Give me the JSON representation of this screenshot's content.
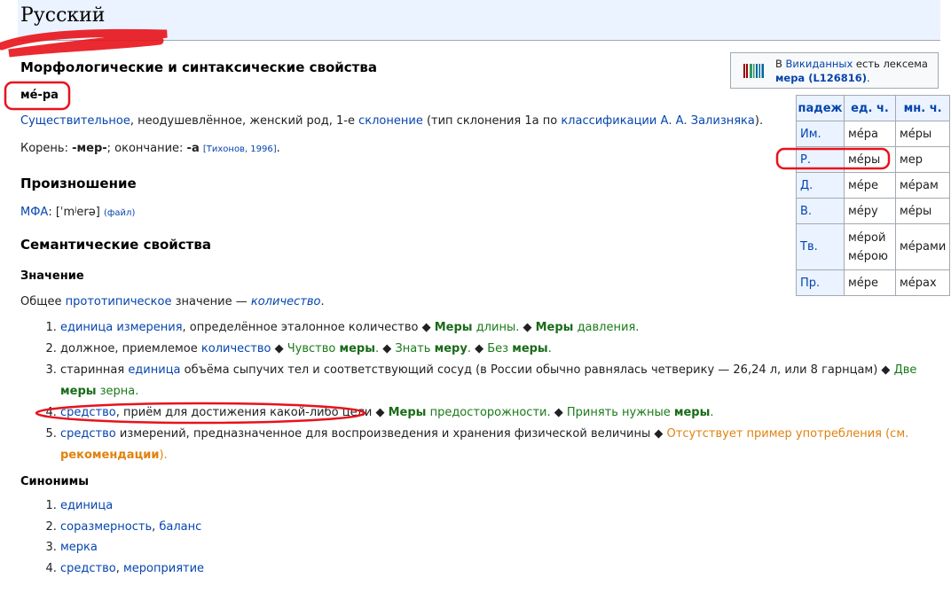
{
  "header": {
    "language": "Русский"
  },
  "morph": {
    "heading": "Морфологические и синтаксические свойства",
    "word": "ме́-ра",
    "pos_link": "Существительное",
    "pos_rest": ", неодушевлённое, женский род, 1-е ",
    "decl_link": "склонение",
    "type_text": " (тип склонения 1a по ",
    "class_link": "классификации А. А. Зализняка",
    "type_end": ").",
    "root_label": "Корень: ",
    "root_value": "-мер-",
    "ending_label": "; окончание: ",
    "ending_value": "-а",
    "source": "[Тихонов, 1996]",
    "source_end": "."
  },
  "wikidata": {
    "pre": "В ",
    "link": "Викиданных",
    "mid": " есть лексема",
    "lexeme": "мера (L126816)",
    "end": "."
  },
  "table": {
    "headers": [
      "падеж",
      "ед. ч.",
      "мн. ч."
    ],
    "rows": [
      {
        "case": "Им.",
        "sg": "ме́ра",
        "pl": "ме́ры"
      },
      {
        "case": "Р.",
        "sg": "ме́ры",
        "pl": "мер"
      },
      {
        "case": "Д.",
        "sg": "ме́ре",
        "pl": "ме́рам"
      },
      {
        "case": "В.",
        "sg": "ме́ру",
        "pl": "ме́ры"
      },
      {
        "case": "Тв.",
        "sg": "ме́рой",
        "sg2": "ме́рою",
        "pl": "ме́рами"
      },
      {
        "case": "Пр.",
        "sg": "ме́ре",
        "pl": "ме́рах"
      }
    ]
  },
  "pron": {
    "heading": "Произношение",
    "ipa_link": "МФА",
    "ipa_text": ": [ˈmʲerə]",
    "file_link": "(файл)"
  },
  "semantic": {
    "heading": "Семантические свойства",
    "meaning_heading": "Значение",
    "general_pre": "Общее ",
    "general_link": "прототипическое",
    "general_mid": " значение — ",
    "general_value": "количество",
    "general_end": ".",
    "defs": [
      {
        "link": "единица измерения",
        "text": ", определённое эталонное количество ◆ ",
        "ex1a": "Меры",
        "ex1b": " длины.",
        "sep": " ◆ ",
        "ex2a": "Меры",
        "ex2b": " давления."
      },
      {
        "pre": "должное, приемлемое ",
        "link": "количество",
        "text": " ◆ ",
        "ex1a": "Чувство ",
        "ex1b": "меры",
        "ex1c": ".",
        "sep1": " ◆ ",
        "ex2a": "Знать ",
        "ex2b": "меру",
        "ex2c": ".",
        "sep2": " ◆ ",
        "ex3a": "Без ",
        "ex3b": "меры",
        "ex3c": "."
      },
      {
        "pre": "старинная ",
        "link": "единица",
        "text": " объёма сыпучих тел и соответствующий сосуд (в России обычно равнялась четверику — 26,24 л, или 8 гарнцам) ◆ ",
        "ex1a": "Две ",
        "ex1b": "меры",
        "ex1c": " зерна."
      },
      {
        "link": "средство",
        "text": ", приём для достижения какой-либо цели ◆ ",
        "ex1a": "Меры",
        "ex1b": " предосторожности.",
        "sep": " ◆ ",
        "ex2a": "Принять нужные ",
        "ex2b": "меры",
        "ex2c": "."
      },
      {
        "link": "средство",
        "text": " измерений, предназначенное для воспроизведения и хранения физической величины ◆ ",
        "missing": "Отсутствует пример употребления (см. ",
        "rec": "рекомендации",
        "missing_end": ")."
      }
    ],
    "syn_heading": "Синонимы",
    "synonyms": [
      [
        "единица"
      ],
      [
        "соразмерность",
        "баланс"
      ],
      [
        "мерка"
      ],
      [
        "средство",
        "мероприятие"
      ]
    ],
    "syn_sep": ", "
  }
}
